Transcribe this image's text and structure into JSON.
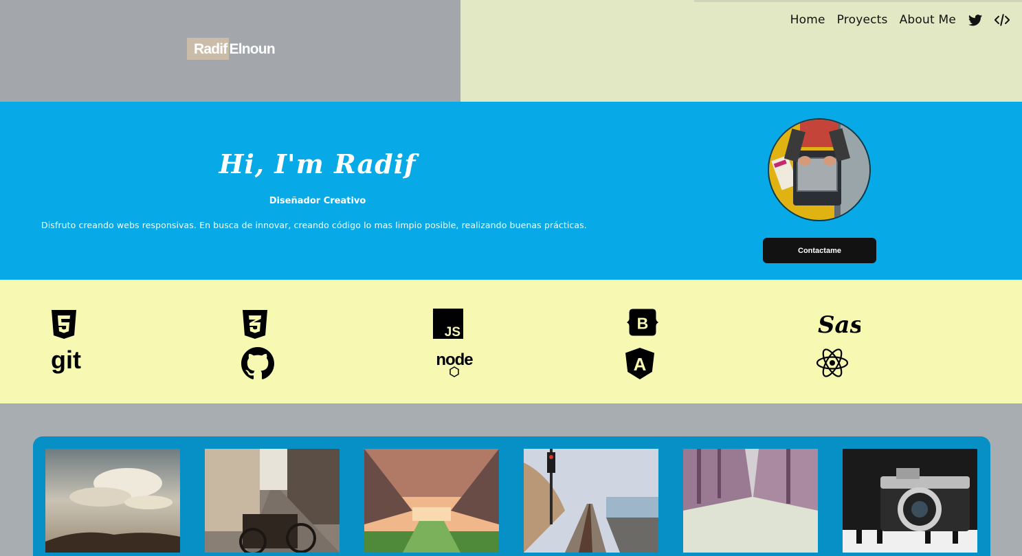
{
  "header": {
    "logo_first": "Radif",
    "logo_second": "Elnoun",
    "nav": [
      "Home",
      "Proyects",
      "About Me"
    ],
    "nav_icons": [
      "twitter-icon",
      "code-icon"
    ]
  },
  "hero": {
    "title": "Hi, I'm Radif",
    "subtitle": "Diseñador Creativo",
    "description": "Disfruto creando webs responsivas. En busca de innovar, creando código lo mas limpio posible, realizando buenas prácticas.",
    "contact_label": "Contactame"
  },
  "skills": {
    "row1": [
      "html5-icon",
      "css3-icon",
      "javascript-icon",
      "bootstrap-icon",
      "sass-icon"
    ],
    "row2": [
      "git-icon",
      "github-icon",
      "nodejs-icon",
      "angular-icon",
      "react-icon"
    ],
    "labels": {
      "git": "git",
      "js": "JS",
      "node": "node",
      "sass": "Sass",
      "bootstrap": "B",
      "angular": "A"
    }
  },
  "gallery": {
    "photos": [
      "clouds-landscape",
      "street-bicycle",
      "tree-tunnel",
      "railway-coast",
      "misty-forest-road",
      "vintage-camera"
    ]
  },
  "colors": {
    "header_left": "#a3a6aa",
    "header_right": "#e2e8c3",
    "hero": "#07a9e6",
    "skills": "#f7f9b3",
    "gallery": "#0690c5",
    "button": "#121212"
  }
}
